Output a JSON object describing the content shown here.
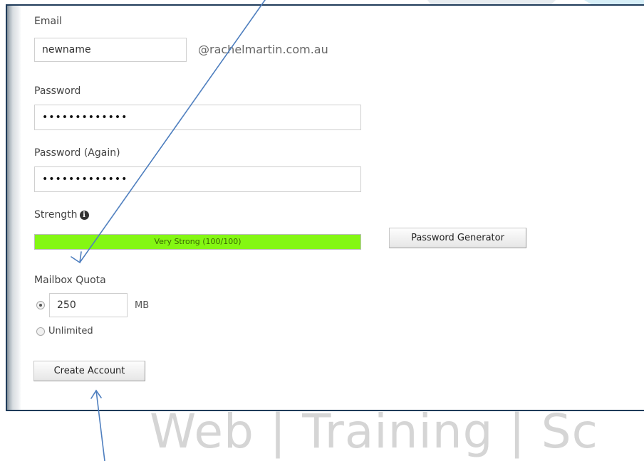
{
  "form": {
    "email_label": "Email",
    "email_value": "newname",
    "email_domain": "@rachelmartin.com.au",
    "password_label": "Password",
    "password_value": "•••••••••••••",
    "password_again_label": "Password (Again)",
    "password_again_value": "•••••••••••••",
    "strength_label": "Strength",
    "strength_icon": "info-icon",
    "strength_text": "Very Strong (100/100)",
    "strength_score": 100,
    "strength_color": "#84f713",
    "password_generator_label": "Password Generator",
    "mailbox_quota_label": "Mailbox Quota",
    "quota_value": "250",
    "quota_unit": "MB",
    "quota_selected": "limited",
    "unlimited_label": "Unlimited",
    "create_account_label": "Create Account"
  },
  "watermark": "Web | Training | Sc",
  "annotation_color": "#4f7fbf"
}
